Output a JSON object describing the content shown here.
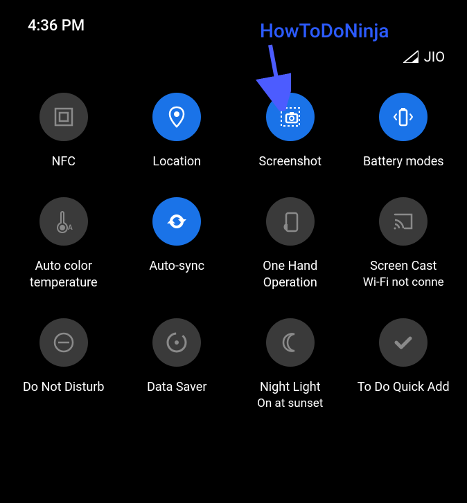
{
  "status": {
    "time": "4:36 PM",
    "carrier": "JIO"
  },
  "annotation": {
    "text": "HowToDoNinja"
  },
  "tiles": [
    {
      "label": "NFC",
      "sublabel": "",
      "state": "off",
      "icon": "nfc"
    },
    {
      "label": "Location",
      "sublabel": "",
      "state": "on",
      "icon": "location"
    },
    {
      "label": "Screenshot",
      "sublabel": "",
      "state": "on",
      "icon": "screenshot"
    },
    {
      "label": "Battery modes",
      "sublabel": "",
      "state": "on",
      "icon": "battery"
    },
    {
      "label": "Auto color temperature",
      "sublabel": "",
      "state": "off",
      "icon": "temperature"
    },
    {
      "label": "Auto-sync",
      "sublabel": "",
      "state": "on",
      "icon": "sync"
    },
    {
      "label": "One Hand Operation",
      "sublabel": "",
      "state": "off",
      "icon": "onehand"
    },
    {
      "label": "Screen Cast",
      "sublabel": "Wi-Fi not conne",
      "state": "off",
      "icon": "cast"
    },
    {
      "label": "Do Not Disturb",
      "sublabel": "",
      "state": "off",
      "icon": "dnd"
    },
    {
      "label": "Data Saver",
      "sublabel": "",
      "state": "off",
      "icon": "datasaver"
    },
    {
      "label": "Night Light",
      "sublabel": "On at sunset",
      "state": "off",
      "icon": "nightlight"
    },
    {
      "label": "To Do Quick Add",
      "sublabel": "",
      "state": "off",
      "icon": "todo"
    }
  ],
  "colors": {
    "on": "#1a73e8",
    "off": "#3a3a3a",
    "annotation": "#2c5bff",
    "arrow": "#4c5cff"
  }
}
